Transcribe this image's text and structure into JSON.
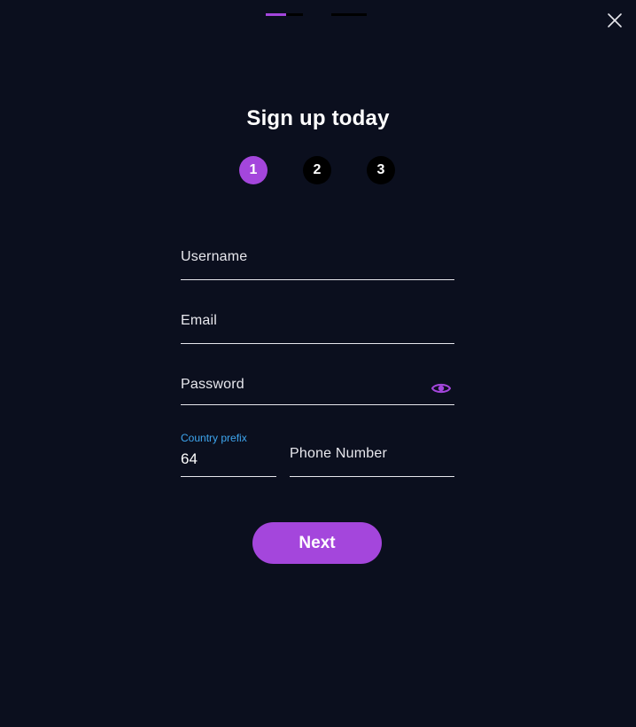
{
  "colors": {
    "background": "#0b0f1e",
    "accent": "#a446dc",
    "step_inactive": "#000000",
    "prefix_label": "#3ea6f0",
    "text": "#ffffff"
  },
  "close_icon": "close-icon",
  "title": "Sign up today",
  "stepper": {
    "current": 1,
    "steps": [
      "1",
      "2",
      "3"
    ]
  },
  "form": {
    "username": {
      "placeholder": "Username",
      "value": ""
    },
    "email": {
      "placeholder": "Email",
      "value": ""
    },
    "password": {
      "placeholder": "Password",
      "value": "",
      "toggle_icon": "eye-icon"
    },
    "country_prefix": {
      "label": "Country prefix",
      "value": "64"
    },
    "phone": {
      "placeholder": "Phone Number",
      "value": ""
    }
  },
  "next_button": "Next"
}
